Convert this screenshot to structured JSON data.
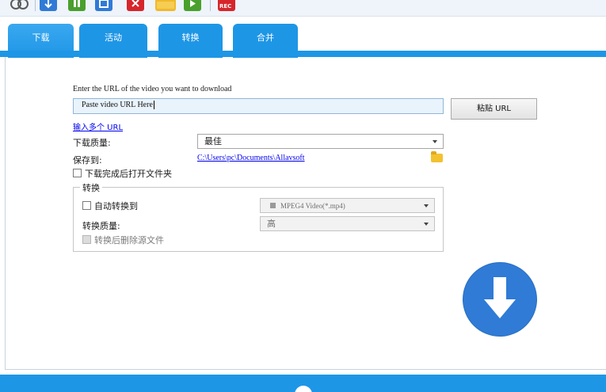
{
  "toolbar": {
    "rec_label": "REC"
  },
  "tabs": [
    "下载",
    "活动",
    "转换",
    "合并"
  ],
  "download": {
    "url_prompt": "Enter the URL of the video you want to download",
    "url_value": "Paste video URL Here",
    "paste_button": "粘贴 URL",
    "multi_url_link": "输入多个 URL",
    "quality_label": "下载质量:",
    "quality_value": "最佳",
    "save_to_label": "保存到:",
    "save_path": "C:\\Users\\pc\\Documents\\Allavsoft",
    "open_folder_label": "下载完成后打开文件夹"
  },
  "convert": {
    "group_title": "转换",
    "auto_convert_label": "自动转换到",
    "format_value": "MPEG4 Video(*.mp4)",
    "quality_label": "转换质量:",
    "quality_value": "高",
    "delete_source_label": "转换后删除源文件"
  },
  "icons": [
    "link-icon",
    "download-icon",
    "pause-icon",
    "stop-icon",
    "delete-icon",
    "folder-icon",
    "play-icon",
    "record-icon",
    "folder-browse-icon",
    "big-download-icon"
  ],
  "colors": {
    "accent": "#1e96e6",
    "download_button": "#2f7bd6"
  }
}
